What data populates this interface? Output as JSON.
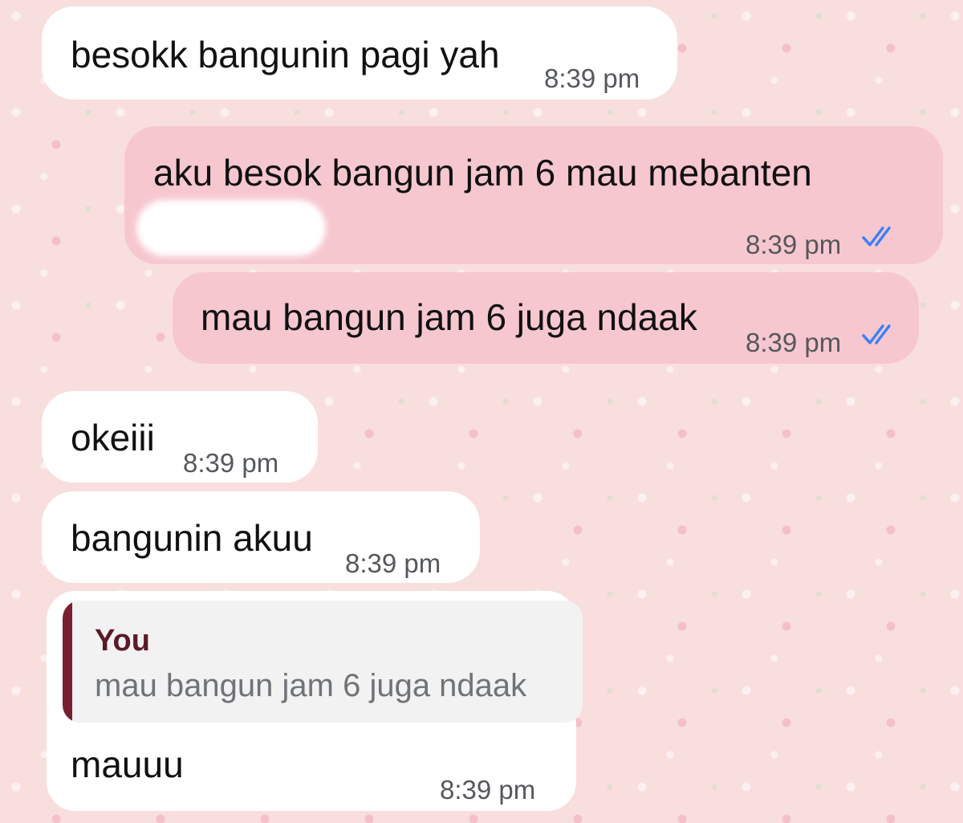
{
  "messages": [
    {
      "direction": "incoming",
      "text": "besokk bangunin pagi yah",
      "time": "8:39 pm"
    },
    {
      "direction": "outgoing",
      "text": "aku besok bangun jam 6 mau mebanten",
      "time": "8:39 pm",
      "status": "read"
    },
    {
      "direction": "outgoing",
      "text": "mau bangun jam 6 juga ndaak",
      "time": "8:39 pm",
      "status": "read"
    },
    {
      "direction": "incoming",
      "text": "okeiii",
      "time": "8:39 pm"
    },
    {
      "direction": "incoming",
      "text": "bangunin akuu",
      "time": "8:39 pm"
    },
    {
      "direction": "incoming",
      "text": "mauuu",
      "time": "8:39 pm",
      "reply_to": {
        "author": "You",
        "text": "mau bangun jam 6 juga ndaak"
      }
    }
  ],
  "colors": {
    "incoming_bubble": "#ffffff",
    "outgoing_bubble": "#f7c7d0",
    "read_ticks": "#3b82f6",
    "reply_bar": "#7a1f30",
    "background": "#f9dede"
  },
  "icons": {
    "read_status": "double-check-icon"
  }
}
